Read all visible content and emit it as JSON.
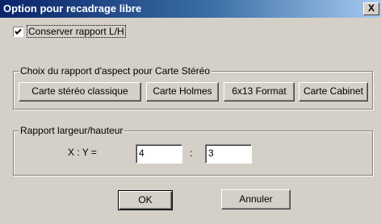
{
  "dialog": {
    "title": "Option pour recadrage libre",
    "close_symbol": "X"
  },
  "keep_ratio": {
    "label": "Conserver rapport L/H",
    "checked": true
  },
  "stereo_group": {
    "legend": "Choix du rapport d'aspect pour Carte Stéréo",
    "buttons": [
      "Carte stéréo classique",
      "Carte Holmes",
      "6x13 Format",
      "Carte Cabinet"
    ]
  },
  "ratio_group": {
    "legend": "Rapport largeur/hauteur",
    "xy_label": "X : Y =",
    "x_value": "4",
    "separator": ":",
    "y_value": "3"
  },
  "footer": {
    "ok_label": "OK",
    "cancel_label": "Annuler"
  }
}
